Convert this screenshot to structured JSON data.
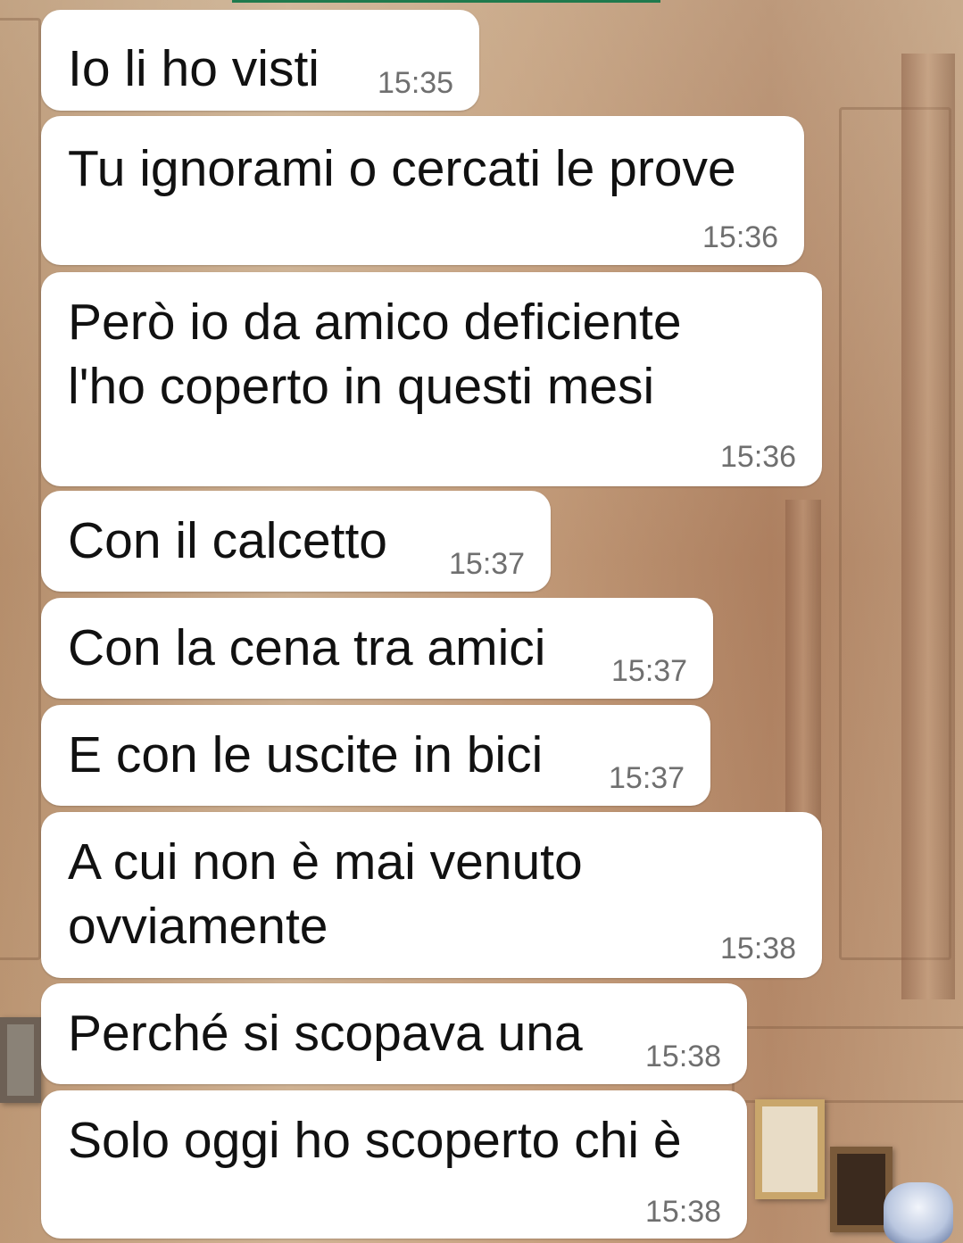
{
  "chat": {
    "messages": [
      {
        "text": "Io li ho visti",
        "time": "15:35"
      },
      {
        "text": "Tu ignorami o cercati le prove",
        "time": "15:36"
      },
      {
        "text": "Però io da amico deficiente\nl'ho coperto in questi mesi",
        "time": "15:36"
      },
      {
        "text": "Con il calcetto",
        "time": "15:37"
      },
      {
        "text": "Con la cena tra amici",
        "time": "15:37"
      },
      {
        "text": "E con le uscite in bici",
        "time": "15:37"
      },
      {
        "text": "A cui non è mai venuto\novviamente",
        "time": "15:38"
      },
      {
        "text": "Perché si scopava una",
        "time": "15:38"
      },
      {
        "text": "Solo oggi ho scoperto chi è",
        "time": "15:38"
      }
    ]
  }
}
